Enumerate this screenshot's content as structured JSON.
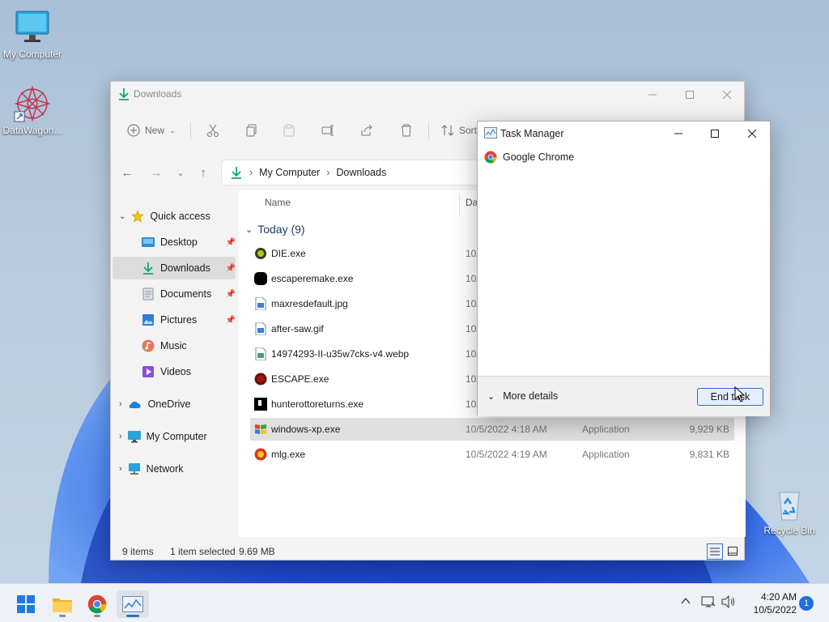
{
  "desktop": {
    "icons": [
      {
        "label": "My Computer"
      },
      {
        "label": "DataWagon..."
      },
      {
        "label": "Recycle Bin"
      }
    ]
  },
  "explorer": {
    "title": "Downloads",
    "toolbar": {
      "new_label": "New",
      "sort_label": "Sort"
    },
    "address": {
      "crumbs": [
        "My Computer",
        "Downloads"
      ]
    },
    "sidebar": {
      "quick_access": "Quick access",
      "items": [
        "Desktop",
        "Downloads",
        "Documents",
        "Pictures",
        "Music",
        "Videos"
      ],
      "onedrive": "OneDrive",
      "my_computer": "My Computer",
      "network": "Network"
    },
    "columns": {
      "name": "Name",
      "date": "Da"
    },
    "group": {
      "label": "Today (9)"
    },
    "files": [
      {
        "name": "DIE.exe",
        "date": "10/",
        "type": "",
        "size": ""
      },
      {
        "name": "escaperemake.exe",
        "date": "10/",
        "type": "",
        "size": ""
      },
      {
        "name": "maxresdefault.jpg",
        "date": "10/",
        "type": "",
        "size": ""
      },
      {
        "name": "after-saw.gif",
        "date": "10/",
        "type": "",
        "size": ""
      },
      {
        "name": "14974293-II-u35w7cks-v4.webp",
        "date": "10/",
        "type": "",
        "size": ""
      },
      {
        "name": "ESCAPE.exe",
        "date": "10/",
        "type": "",
        "size": ""
      },
      {
        "name": "hunterottoreturns.exe",
        "date": "10/",
        "type": "",
        "size": ""
      },
      {
        "name": "windows-xp.exe",
        "date": "10/5/2022 4:18 AM",
        "type": "Application",
        "size": "9,929 KB"
      },
      {
        "name": "mlg.exe",
        "date": "10/5/2022 4:19 AM",
        "type": "Application",
        "size": "9,831 KB"
      }
    ],
    "status": {
      "count": "9 items",
      "selected": "1 item selected",
      "size": "9.69 MB"
    }
  },
  "taskmgr": {
    "title": "Task Manager",
    "app": "Google Chrome",
    "more_details": "More details",
    "end_task": "End task"
  },
  "taskbar": {
    "time": "4:20 AM",
    "date": "10/5/2022",
    "notifications": "1"
  }
}
